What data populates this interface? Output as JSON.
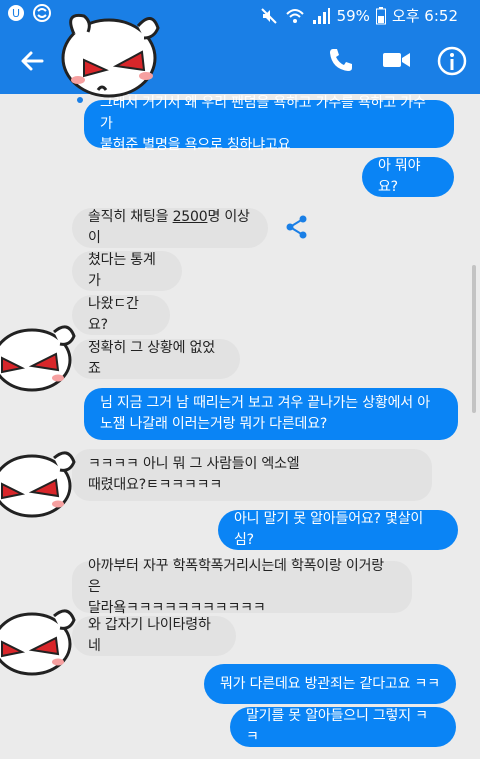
{
  "status_bar": {
    "battery": "59%",
    "time": "오후 6:52",
    "icons": [
      "notification-app-icon",
      "sync-app-icon",
      "mute-icon",
      "wifi-icon",
      "signal-icon",
      "battery-icon"
    ]
  },
  "header": {
    "icons": [
      "back-arrow-icon",
      "phone-icon",
      "video-call-icon",
      "info-icon"
    ]
  },
  "messages": [
    {
      "dir": "sent",
      "lines": [
        "그래서 거기서 왜 우리 팬덤을 욕하고 가수를 욕하고 가수가",
        "붙혀준 별명을 욕으로 칭하냐고요"
      ]
    },
    {
      "dir": "sent",
      "lines": [
        "아 뭐야요?"
      ]
    },
    {
      "dir": "recv",
      "prefix": "솔직히 채팅을 ",
      "underlined": "2500",
      "suffix": "명 이상이"
    },
    {
      "dir": "recv",
      "lines": [
        "쳤다는 통계가"
      ]
    },
    {
      "dir": "recv",
      "lines": [
        "나왔ㄷ간요?"
      ]
    },
    {
      "dir": "recv",
      "lines": [
        "정확히 그 상황에 없었죠"
      ]
    },
    {
      "dir": "sent",
      "lines": [
        "님 지금 그거 남 때리는거 보고 겨우 끝나가는 상황에서 아",
        "노잼 나갈래 이러는거랑 뭐가 다른데요?"
      ]
    },
    {
      "dir": "recv",
      "lines": [
        "ㅋㅋㅋㅋ 아니 뭐 그 사람들이 엑소엘",
        "때렸대요?ㅌㅋㅋㅋㅋㅋ"
      ]
    },
    {
      "dir": "sent",
      "lines": [
        "아니 말기 못 알아들어요? 몇살이심?"
      ]
    },
    {
      "dir": "recv",
      "lines": [
        "아까부터 자꾸 학폭학폭거리시는데 학폭이랑 이거랑은",
        "달라욬ㅋㅋㅋㅋㅋㅋㅋㅋㅋㅋㅋ"
      ]
    },
    {
      "dir": "recv",
      "lines": [
        "와 갑자기 나이타령하네"
      ]
    },
    {
      "dir": "sent",
      "lines": [
        "뭐가 다른데요 방관죄는 같다고요 ㅋㅋ"
      ]
    },
    {
      "dir": "sent",
      "lines": [
        "말기를 못 알아들으니 그렇지 ㅋㅋ"
      ]
    }
  ],
  "colors": {
    "header": "#1a7fe6",
    "sent_bubble": "#0a84f5",
    "received_bubble": "#e2e2e2",
    "background": "#ebebeb"
  }
}
